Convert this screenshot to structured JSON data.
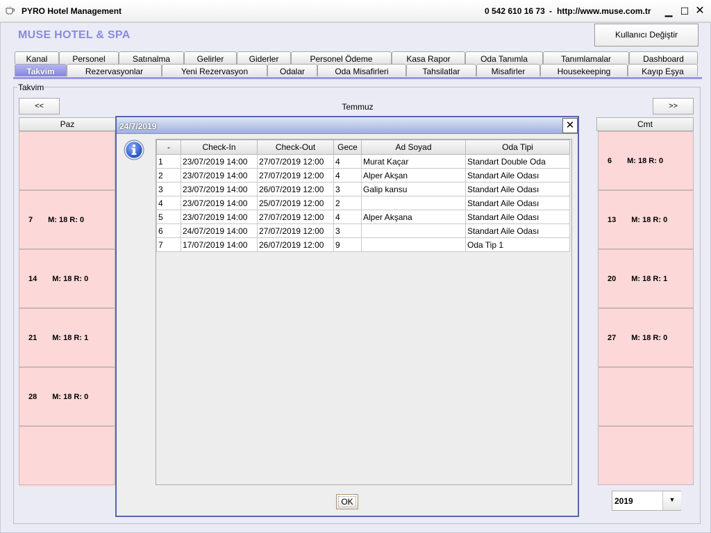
{
  "window": {
    "title": "PYRO Hotel Management",
    "phone": "0 542 610 16 73",
    "separator": "-",
    "url": "http://www.muse.com.tr",
    "min_label": "▁",
    "max_label": "☐",
    "close_label": "✕"
  },
  "header": {
    "hotel_name": "MUSE HOTEL & SPA",
    "user_button": "Kullanıcı Değiştir"
  },
  "tabs": {
    "row1": [
      "Kanal",
      "Personel",
      "Satınalma",
      "Gelirler",
      "Giderler",
      "Personel Ödeme",
      "Kasa Rapor",
      "Oda Tanımla",
      "Tanımlamalar",
      "Dashboard"
    ],
    "row2": [
      "Takvim",
      "Rezervasyonlar",
      "Yeni Rezervasyon",
      "Odalar",
      "Oda Misafirleri",
      "Tahsilatlar",
      "Misafirler",
      "Housekeeping",
      "Kayıp Eşya"
    ],
    "active": "Takvim"
  },
  "calendar": {
    "legend": "Takvim",
    "prev_label": "<<",
    "next_label": ">>",
    "month": "Temmuz",
    "left_header": "Paz",
    "right_header": "Cmt",
    "left_cells": [
      {
        "day": "",
        "info": ""
      },
      {
        "day": "7",
        "info": "M: 18 R: 0"
      },
      {
        "day": "14",
        "info": "M: 18 R: 0"
      },
      {
        "day": "21",
        "info": "M: 18 R: 1"
      },
      {
        "day": "28",
        "info": "M: 18 R: 0"
      },
      {
        "day": "",
        "info": ""
      }
    ],
    "right_cells": [
      {
        "day": "6",
        "info": "M: 18 R: 0"
      },
      {
        "day": "13",
        "info": "M: 18 R: 0"
      },
      {
        "day": "20",
        "info": "M: 18 R: 1"
      },
      {
        "day": "27",
        "info": "M: 18 R: 0"
      },
      {
        "day": "",
        "info": ""
      },
      {
        "day": "",
        "info": ""
      }
    ],
    "year": "2019",
    "year_arrow": "▼"
  },
  "dialog": {
    "title": "24/7/2019",
    "close_label": "✕",
    "ok_label": "OK",
    "columns": [
      "-",
      "Check-In",
      "Check-Out",
      "Gece",
      "Ad Soyad",
      "Oda Tipi"
    ],
    "rows": [
      [
        "1",
        "23/07/2019 14:00",
        "27/07/2019 12:00",
        "4",
        "Murat Kaçar",
        "Standart Double Oda"
      ],
      [
        "2",
        "23/07/2019 14:00",
        "27/07/2019 12:00",
        "4",
        "Alper Akşan",
        "Standart Aile Odası"
      ],
      [
        "3",
        "23/07/2019 14:00",
        "26/07/2019 12:00",
        "3",
        "Galip kansu",
        "Standart Aile Odası"
      ],
      [
        "4",
        "23/07/2019 14:00",
        "25/07/2019 12:00",
        "2",
        "",
        "Standart Aile Odası"
      ],
      [
        "5",
        "23/07/2019 14:00",
        "27/07/2019 12:00",
        "4",
        "Alper Akşana",
        "Standart Aile Odası"
      ],
      [
        "6",
        "24/07/2019 14:00",
        "27/07/2019 12:00",
        "3",
        "",
        "Standart Aile Odası"
      ],
      [
        "7",
        "17/07/2019 14:00",
        "26/07/2019 12:00",
        "9",
        "",
        "Oda Tip 1"
      ]
    ]
  },
  "colors": {
    "accent": "#8585d8",
    "cell_pink": "#fcd8d8",
    "dialog_border": "#5566aa"
  },
  "icons": [
    "coffee-cup-icon",
    "info-icon",
    "close-icon",
    "minimize-icon",
    "maximize-icon",
    "dropdown-arrow-icon"
  ]
}
